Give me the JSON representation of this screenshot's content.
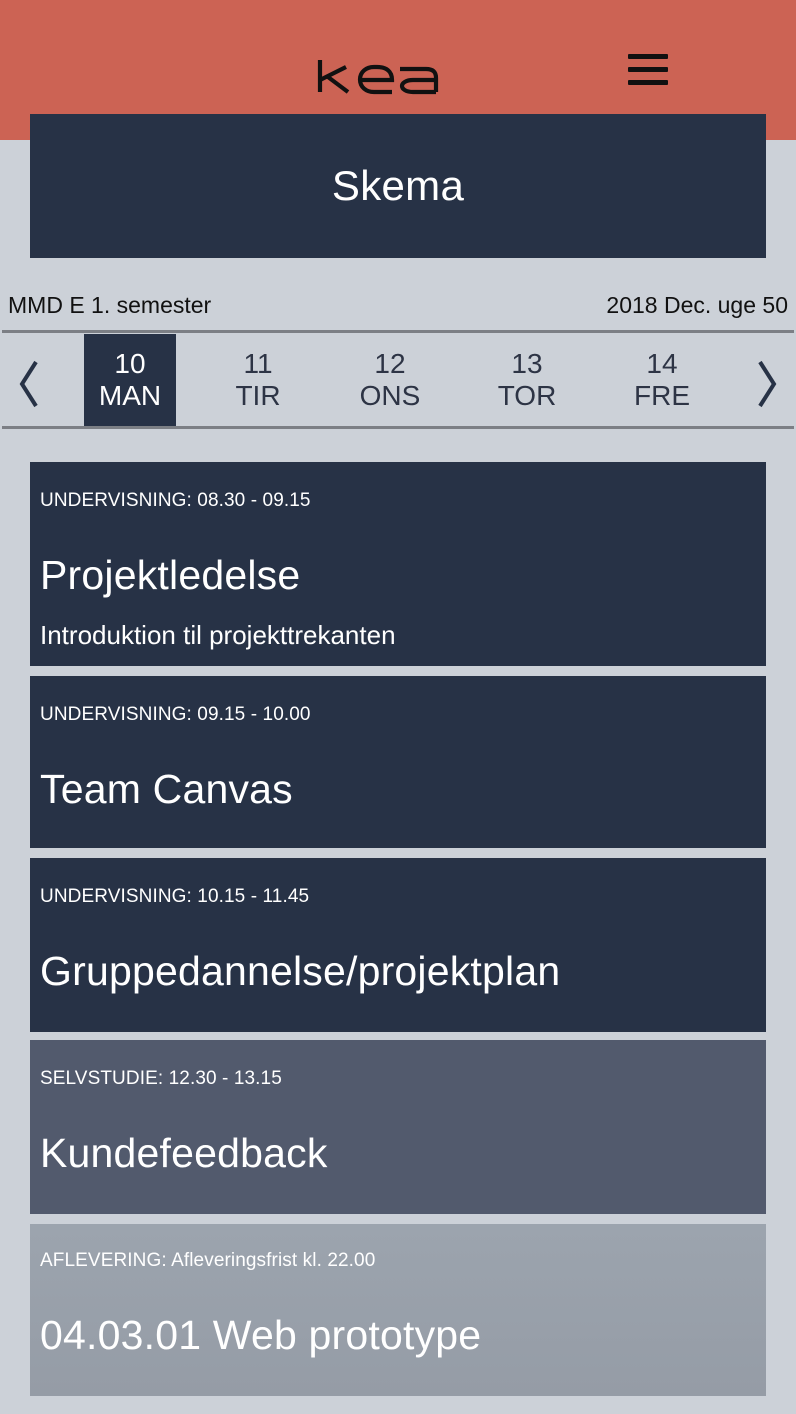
{
  "header": {
    "logo_text": "kea",
    "menu_icon": "hamburger-menu-icon",
    "brand_color": "#cc6354"
  },
  "page": {
    "title": "Skema"
  },
  "info": {
    "class_name": "MMD E 1. semester",
    "week_label": "2018 Dec. uge 50"
  },
  "week_nav": {
    "prev_icon": "chevron-left-icon",
    "next_icon": "chevron-right-icon",
    "days": [
      {
        "num": "10",
        "name": "MAN",
        "selected": true
      },
      {
        "num": "11",
        "name": "TIR",
        "selected": false
      },
      {
        "num": "12",
        "name": "ONS",
        "selected": false
      },
      {
        "num": "13",
        "name": "TOR",
        "selected": false
      },
      {
        "num": "14",
        "name": "FRE",
        "selected": false
      }
    ]
  },
  "events": [
    {
      "meta": "UNDERVISNING: 08.30 - 09.15",
      "title": "Projektledelse",
      "description": "Introduktion til projekttrekanten",
      "kind": "dark"
    },
    {
      "meta": "UNDERVISNING: 09.15 - 10.00",
      "title": "Team Canvas",
      "kind": "dark"
    },
    {
      "meta": "UNDERVISNING: 10.15 - 11.45",
      "title": "Gruppedannelse/projektplan",
      "kind": "dark"
    },
    {
      "meta": "SELVSTUDIE: 12.30 - 13.15",
      "title": "Kundefeedback",
      "kind": "mid"
    },
    {
      "meta": "AFLEVERING: Afleveringsfrist kl. 22.00",
      "title": "04.03.01 Web prototype",
      "kind": "light"
    }
  ],
  "colors": {
    "page_bg": "#ccd1d8",
    "card_dark": "#273246",
    "card_mid": "#525a6d",
    "card_light": "#9ca4ae"
  }
}
